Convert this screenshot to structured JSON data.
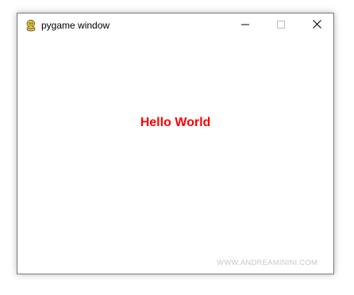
{
  "window": {
    "title": "pygame window",
    "icon": "pygame-snake-icon",
    "controls": {
      "minimize_icon": "minimize-icon",
      "maximize_icon": "maximize-icon",
      "close_icon": "close-icon"
    }
  },
  "canvas": {
    "text": "Hello World",
    "text_color": "#ff0000",
    "background_color": "#ffffff"
  },
  "watermark": {
    "text": "WWW.ANDREAMININI.COM"
  }
}
